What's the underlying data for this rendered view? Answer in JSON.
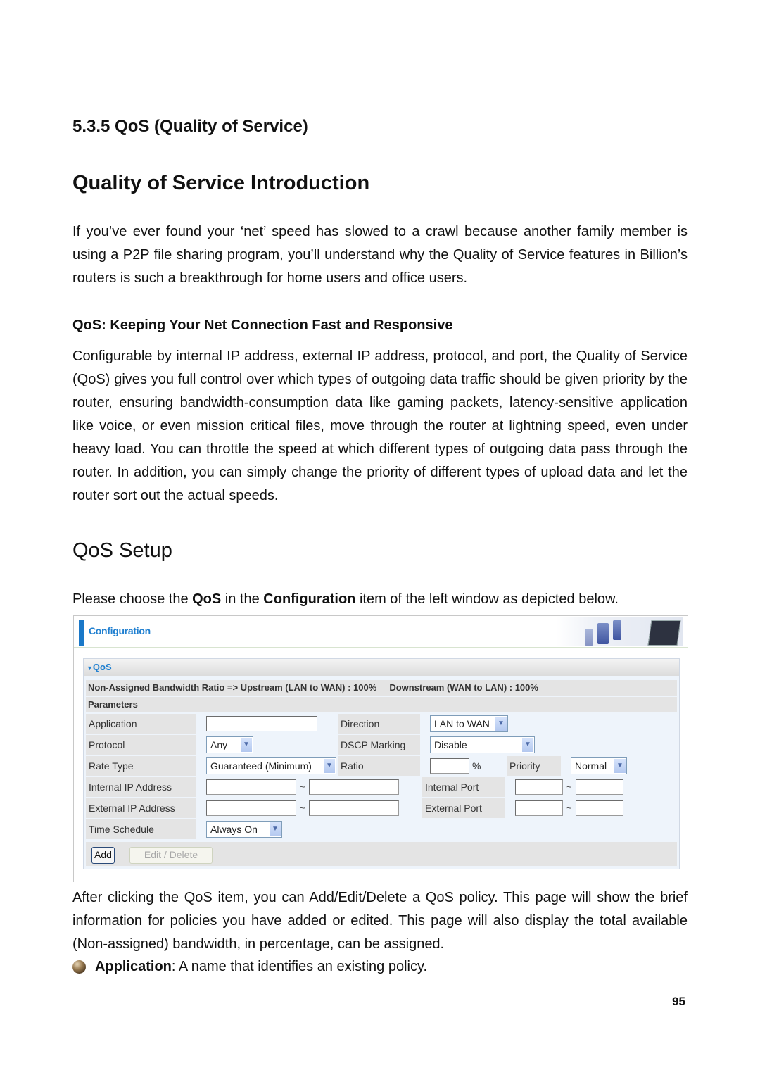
{
  "section_heading": "5.3.5 QoS (Quality of Service)",
  "intro_heading": "Quality of Service Introduction",
  "intro_paragraph": "If you’ve ever found your ‘net’ speed has slowed to a crawl because another family member is using a P2P file sharing program, you’ll understand why the Quality of Service features in Billion’s routers is such a breakthrough for home users and office users.",
  "subheading": "QoS: Keeping Your Net Connection Fast and Responsive",
  "qos_paragraph": "Configurable by internal IP address, external IP address, protocol, and port, the Quality of Service (QoS) gives you full control over which types of outgoing data traffic should be given priority by the router, ensuring bandwidth-consumption data like gaming packets, latency-sensitive application like voice, or even mission critical files, move through the router at lightning speed, even under heavy load. You can throttle the speed at which different types of outgoing data pass through the router. In addition, you can simply change the priority of different types of upload data and let the router sort out the actual speeds.",
  "setup_heading": "QoS Setup",
  "setup_instruction": {
    "before": "Please choose the ",
    "bold1": "QoS",
    "middle": " in the ",
    "bold2": "Configuration",
    "after": " item of the left window as depicted below."
  },
  "screenshot": {
    "header_title": "Configuration",
    "panel_title": "QoS",
    "bandwidth_ratio": "Non-Assigned Bandwidth Ratio => Upstream (LAN to WAN) : 100%     Downstream (WAN to LAN) : 100%",
    "parameters_label": "Parameters",
    "fields": {
      "application_label": "Application",
      "application_value": "",
      "direction_label": "Direction",
      "direction_value": "LAN to WAN",
      "protocol_label": "Protocol",
      "protocol_value": "Any",
      "dscp_label": "DSCP Marking",
      "dscp_value": "Disable",
      "rate_type_label": "Rate Type",
      "rate_type_value": "Guaranteed (Minimum)",
      "ratio_label": "Ratio",
      "ratio_value": "",
      "ratio_unit": "%",
      "priority_label": "Priority",
      "priority_value": "Normal",
      "internal_ip_label": "Internal IP Address",
      "external_ip_label": "External IP Address",
      "internal_port_label": "Internal Port",
      "external_port_label": "External Port",
      "range_separator": "~",
      "time_schedule_label": "Time Schedule",
      "time_schedule_value": "Always On"
    },
    "add_button": "Add",
    "edit_delete_button": "Edit / Delete"
  },
  "after_paragraph": "After clicking the QoS item, you can Add/Edit/Delete a QoS policy. This page will show the brief information for policies you have added or edited. This page will also display the total available (Non-assigned) bandwidth, in percentage, can be assigned.",
  "bullet": {
    "term": "Application",
    "description": ": A name that identifies an existing policy."
  },
  "page_number": "95"
}
